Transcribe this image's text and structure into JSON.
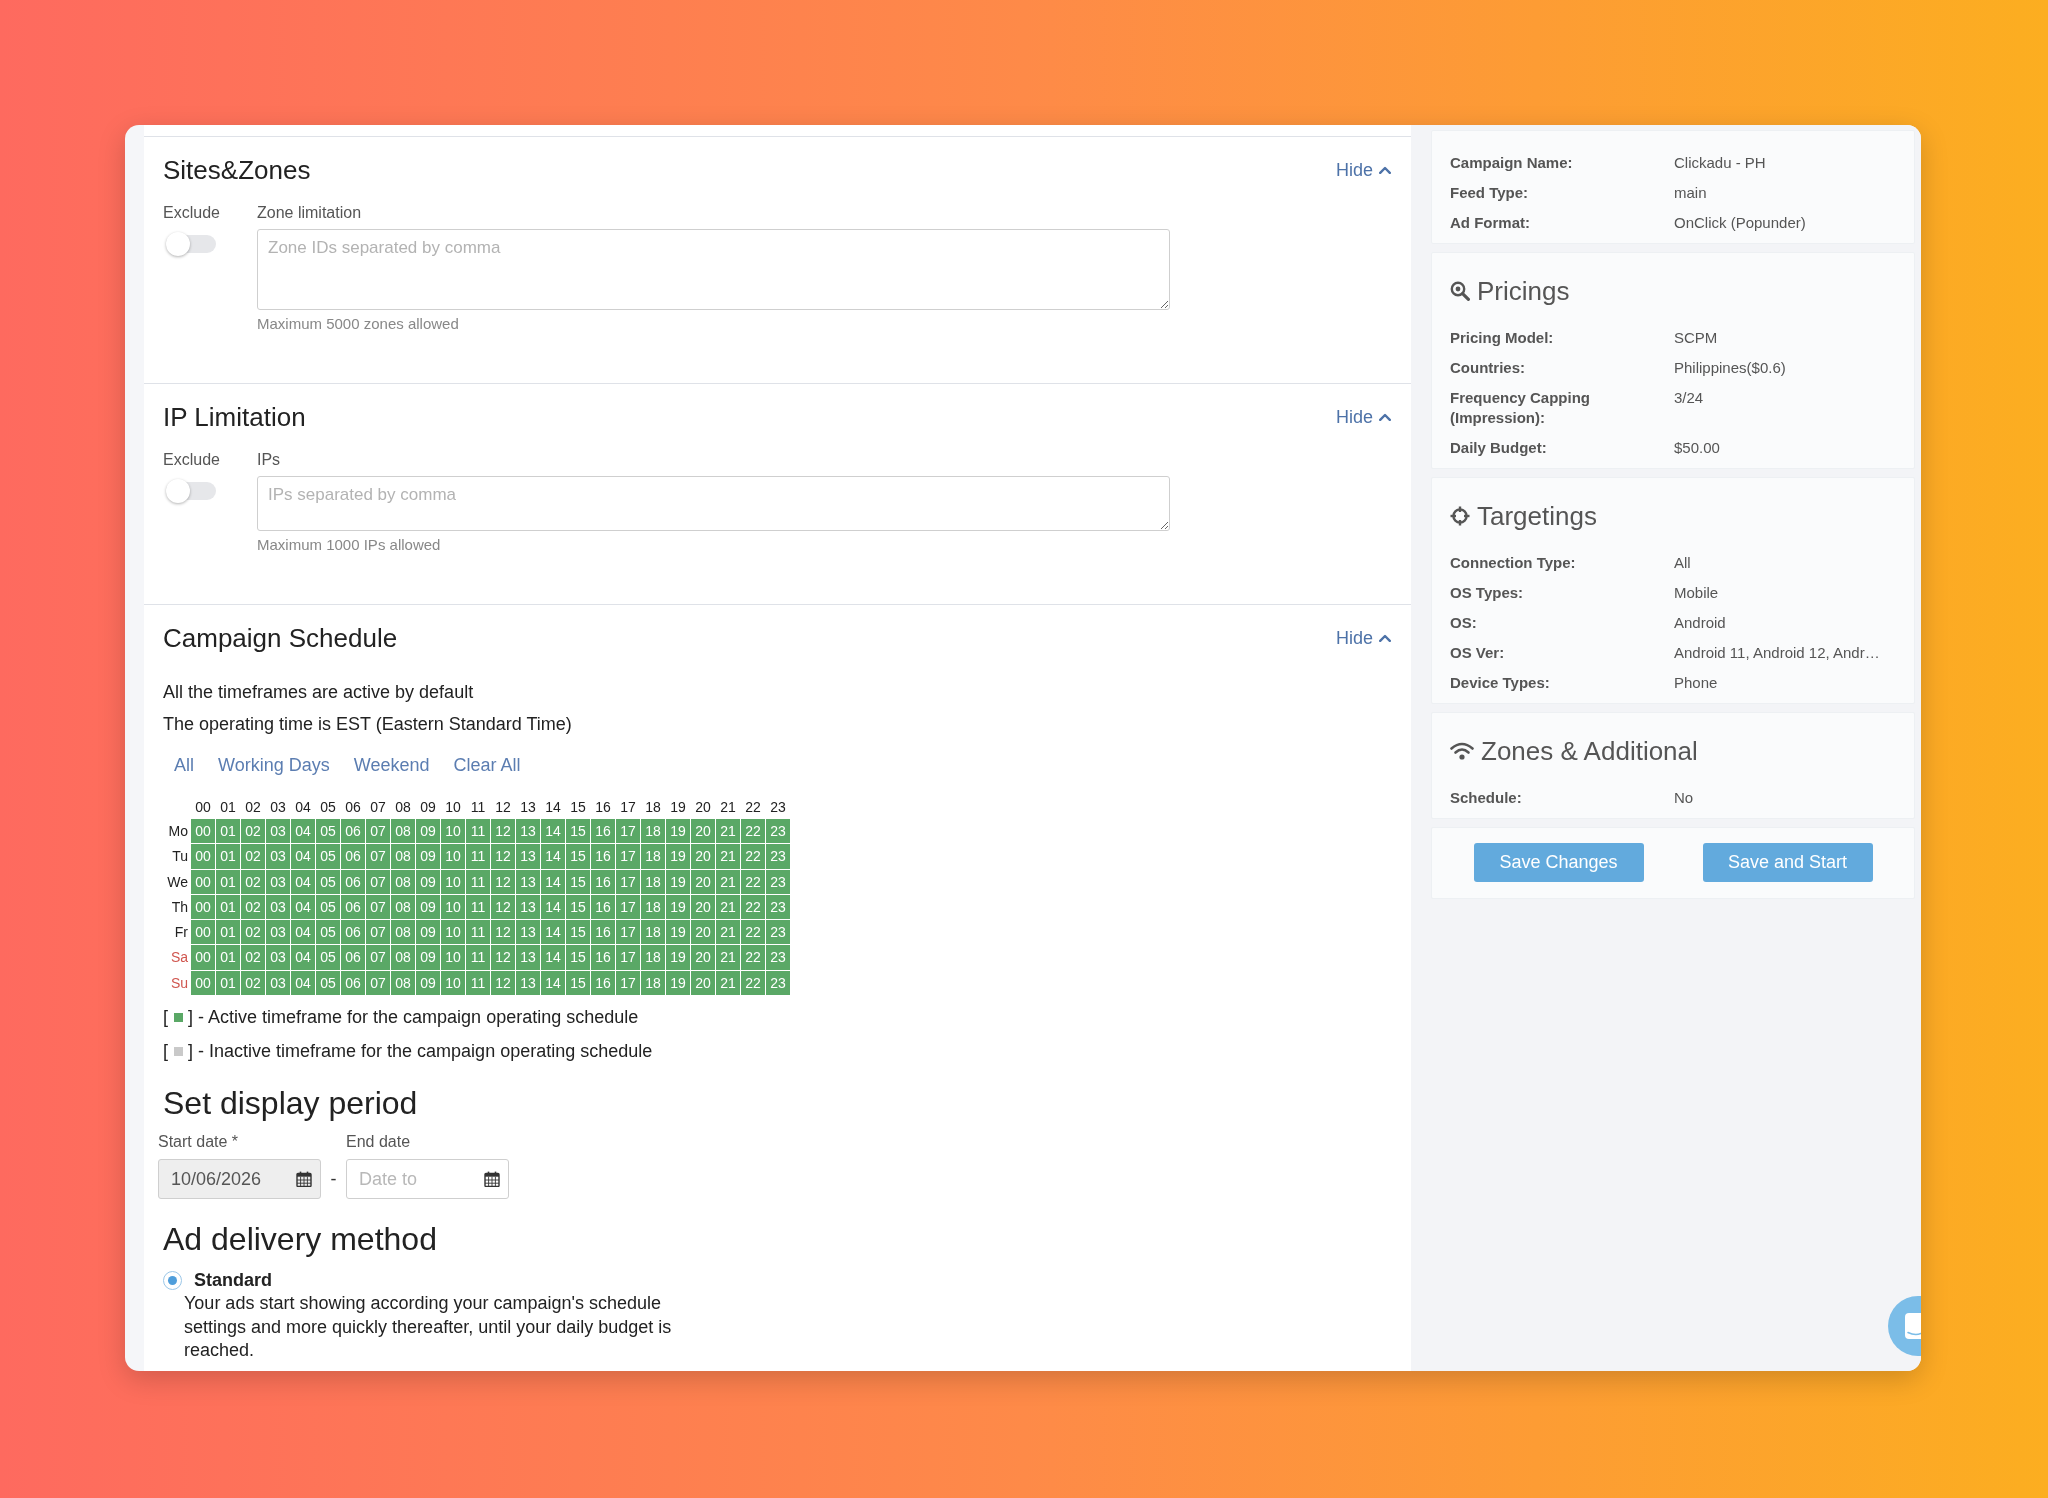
{
  "sites_zones": {
    "title": "Sites&Zones",
    "hide": "Hide",
    "exclude": {
      "label": "Exclude",
      "on": false
    },
    "field": {
      "label": "Zone limitation",
      "placeholder": "Zone IDs separated by comma",
      "help": "Maximum 5000 zones allowed"
    }
  },
  "ip_limitation": {
    "title": "IP Limitation",
    "hide": "Hide",
    "exclude": {
      "label": "Exclude",
      "on": false
    },
    "field": {
      "label": "IPs",
      "placeholder": "IPs separated by comma",
      "help": "Maximum 1000 IPs allowed"
    }
  },
  "schedule": {
    "title": "Campaign Schedule",
    "hide": "Hide",
    "notes": [
      "All the timeframes are active by default",
      "The operating time is EST (Eastern Standard Time)"
    ],
    "presets": [
      "All",
      "Working Days",
      "Weekend",
      "Clear All"
    ],
    "hours": [
      "00",
      "01",
      "02",
      "03",
      "04",
      "05",
      "06",
      "07",
      "08",
      "09",
      "10",
      "11",
      "12",
      "13",
      "14",
      "15",
      "16",
      "17",
      "18",
      "19",
      "20",
      "21",
      "22",
      "23"
    ],
    "days": [
      {
        "label": "Mo",
        "weekend": false,
        "slots": [
          {
            "hour": "00",
            "active": true
          },
          {
            "hour": "01",
            "active": true
          },
          {
            "hour": "02",
            "active": true
          },
          {
            "hour": "03",
            "active": true
          },
          {
            "hour": "04",
            "active": true
          },
          {
            "hour": "05",
            "active": true
          },
          {
            "hour": "06",
            "active": true
          },
          {
            "hour": "07",
            "active": true
          },
          {
            "hour": "08",
            "active": true
          },
          {
            "hour": "09",
            "active": true
          },
          {
            "hour": "10",
            "active": true
          },
          {
            "hour": "11",
            "active": true
          },
          {
            "hour": "12",
            "active": true
          },
          {
            "hour": "13",
            "active": true
          },
          {
            "hour": "14",
            "active": true
          },
          {
            "hour": "15",
            "active": true
          },
          {
            "hour": "16",
            "active": true
          },
          {
            "hour": "17",
            "active": true
          },
          {
            "hour": "18",
            "active": true
          },
          {
            "hour": "19",
            "active": true
          },
          {
            "hour": "20",
            "active": true
          },
          {
            "hour": "21",
            "active": true
          },
          {
            "hour": "22",
            "active": true
          },
          {
            "hour": "23",
            "active": true
          }
        ]
      },
      {
        "label": "Tu",
        "weekend": false,
        "slots": [
          {
            "hour": "00",
            "active": true
          },
          {
            "hour": "01",
            "active": true
          },
          {
            "hour": "02",
            "active": true
          },
          {
            "hour": "03",
            "active": true
          },
          {
            "hour": "04",
            "active": true
          },
          {
            "hour": "05",
            "active": true
          },
          {
            "hour": "06",
            "active": true
          },
          {
            "hour": "07",
            "active": true
          },
          {
            "hour": "08",
            "active": true
          },
          {
            "hour": "09",
            "active": true
          },
          {
            "hour": "10",
            "active": true
          },
          {
            "hour": "11",
            "active": true
          },
          {
            "hour": "12",
            "active": true
          },
          {
            "hour": "13",
            "active": true
          },
          {
            "hour": "14",
            "active": true
          },
          {
            "hour": "15",
            "active": true
          },
          {
            "hour": "16",
            "active": true
          },
          {
            "hour": "17",
            "active": true
          },
          {
            "hour": "18",
            "active": true
          },
          {
            "hour": "19",
            "active": true
          },
          {
            "hour": "20",
            "active": true
          },
          {
            "hour": "21",
            "active": true
          },
          {
            "hour": "22",
            "active": true
          },
          {
            "hour": "23",
            "active": true
          }
        ]
      },
      {
        "label": "We",
        "weekend": false,
        "slots": [
          {
            "hour": "00",
            "active": true
          },
          {
            "hour": "01",
            "active": true
          },
          {
            "hour": "02",
            "active": true
          },
          {
            "hour": "03",
            "active": true
          },
          {
            "hour": "04",
            "active": true
          },
          {
            "hour": "05",
            "active": true
          },
          {
            "hour": "06",
            "active": true
          },
          {
            "hour": "07",
            "active": true
          },
          {
            "hour": "08",
            "active": true
          },
          {
            "hour": "09",
            "active": true
          },
          {
            "hour": "10",
            "active": true
          },
          {
            "hour": "11",
            "active": true
          },
          {
            "hour": "12",
            "active": true
          },
          {
            "hour": "13",
            "active": true
          },
          {
            "hour": "14",
            "active": true
          },
          {
            "hour": "15",
            "active": true
          },
          {
            "hour": "16",
            "active": true
          },
          {
            "hour": "17",
            "active": true
          },
          {
            "hour": "18",
            "active": true
          },
          {
            "hour": "19",
            "active": true
          },
          {
            "hour": "20",
            "active": true
          },
          {
            "hour": "21",
            "active": true
          },
          {
            "hour": "22",
            "active": true
          },
          {
            "hour": "23",
            "active": true
          }
        ]
      },
      {
        "label": "Th",
        "weekend": false,
        "slots": [
          {
            "hour": "00",
            "active": true
          },
          {
            "hour": "01",
            "active": true
          },
          {
            "hour": "02",
            "active": true
          },
          {
            "hour": "03",
            "active": true
          },
          {
            "hour": "04",
            "active": true
          },
          {
            "hour": "05",
            "active": true
          },
          {
            "hour": "06",
            "active": true
          },
          {
            "hour": "07",
            "active": true
          },
          {
            "hour": "08",
            "active": true
          },
          {
            "hour": "09",
            "active": true
          },
          {
            "hour": "10",
            "active": true
          },
          {
            "hour": "11",
            "active": true
          },
          {
            "hour": "12",
            "active": true
          },
          {
            "hour": "13",
            "active": true
          },
          {
            "hour": "14",
            "active": true
          },
          {
            "hour": "15",
            "active": true
          },
          {
            "hour": "16",
            "active": true
          },
          {
            "hour": "17",
            "active": true
          },
          {
            "hour": "18",
            "active": true
          },
          {
            "hour": "19",
            "active": true
          },
          {
            "hour": "20",
            "active": true
          },
          {
            "hour": "21",
            "active": true
          },
          {
            "hour": "22",
            "active": true
          },
          {
            "hour": "23",
            "active": true
          }
        ]
      },
      {
        "label": "Fr",
        "weekend": false,
        "slots": [
          {
            "hour": "00",
            "active": true
          },
          {
            "hour": "01",
            "active": true
          },
          {
            "hour": "02",
            "active": true
          },
          {
            "hour": "03",
            "active": true
          },
          {
            "hour": "04",
            "active": true
          },
          {
            "hour": "05",
            "active": true
          },
          {
            "hour": "06",
            "active": true
          },
          {
            "hour": "07",
            "active": true
          },
          {
            "hour": "08",
            "active": true
          },
          {
            "hour": "09",
            "active": true
          },
          {
            "hour": "10",
            "active": true
          },
          {
            "hour": "11",
            "active": true
          },
          {
            "hour": "12",
            "active": true
          },
          {
            "hour": "13",
            "active": true
          },
          {
            "hour": "14",
            "active": true
          },
          {
            "hour": "15",
            "active": true
          },
          {
            "hour": "16",
            "active": true
          },
          {
            "hour": "17",
            "active": true
          },
          {
            "hour": "18",
            "active": true
          },
          {
            "hour": "19",
            "active": true
          },
          {
            "hour": "20",
            "active": true
          },
          {
            "hour": "21",
            "active": true
          },
          {
            "hour": "22",
            "active": true
          },
          {
            "hour": "23",
            "active": true
          }
        ]
      },
      {
        "label": "Sa",
        "weekend": true,
        "slots": [
          {
            "hour": "00",
            "active": true
          },
          {
            "hour": "01",
            "active": true
          },
          {
            "hour": "02",
            "active": true
          },
          {
            "hour": "03",
            "active": true
          },
          {
            "hour": "04",
            "active": true
          },
          {
            "hour": "05",
            "active": true
          },
          {
            "hour": "06",
            "active": true
          },
          {
            "hour": "07",
            "active": true
          },
          {
            "hour": "08",
            "active": true
          },
          {
            "hour": "09",
            "active": true
          },
          {
            "hour": "10",
            "active": true
          },
          {
            "hour": "11",
            "active": true
          },
          {
            "hour": "12",
            "active": true
          },
          {
            "hour": "13",
            "active": true
          },
          {
            "hour": "14",
            "active": true
          },
          {
            "hour": "15",
            "active": true
          },
          {
            "hour": "16",
            "active": true
          },
          {
            "hour": "17",
            "active": true
          },
          {
            "hour": "18",
            "active": true
          },
          {
            "hour": "19",
            "active": true
          },
          {
            "hour": "20",
            "active": true
          },
          {
            "hour": "21",
            "active": true
          },
          {
            "hour": "22",
            "active": true
          },
          {
            "hour": "23",
            "active": true
          }
        ]
      },
      {
        "label": "Su",
        "weekend": true,
        "slots": [
          {
            "hour": "00",
            "active": true
          },
          {
            "hour": "01",
            "active": true
          },
          {
            "hour": "02",
            "active": true
          },
          {
            "hour": "03",
            "active": true
          },
          {
            "hour": "04",
            "active": true
          },
          {
            "hour": "05",
            "active": true
          },
          {
            "hour": "06",
            "active": true
          },
          {
            "hour": "07",
            "active": true
          },
          {
            "hour": "08",
            "active": true
          },
          {
            "hour": "09",
            "active": true
          },
          {
            "hour": "10",
            "active": true
          },
          {
            "hour": "11",
            "active": true
          },
          {
            "hour": "12",
            "active": true
          },
          {
            "hour": "13",
            "active": true
          },
          {
            "hour": "14",
            "active": true
          },
          {
            "hour": "15",
            "active": true
          },
          {
            "hour": "16",
            "active": true
          },
          {
            "hour": "17",
            "active": true
          },
          {
            "hour": "18",
            "active": true
          },
          {
            "hour": "19",
            "active": true
          },
          {
            "hour": "20",
            "active": true
          },
          {
            "hour": "21",
            "active": true
          },
          {
            "hour": "22",
            "active": true
          },
          {
            "hour": "23",
            "active": true
          }
        ]
      }
    ],
    "legend": [
      {
        "open": "[",
        "text": "] - Active timeframe for the campaign operating schedule",
        "active": true
      },
      {
        "open": "[",
        "text": "] - Inactive timeframe for the campaign operating schedule",
        "active": false
      }
    ]
  },
  "display_period": {
    "title": "Set display period",
    "start": {
      "label": "Start date *",
      "value": "10/06/2026",
      "disabled": true
    },
    "separator": "-",
    "end": {
      "label": "End date",
      "placeholder": "Date to",
      "disabled": false
    }
  },
  "ad_delivery": {
    "title": "Ad delivery method",
    "options": [
      {
        "label": "Standard",
        "description": "Your ads start showing according your campaign's schedule settings and more quickly thereafter, until your daily budget is reached.",
        "selected": true
      }
    ]
  },
  "summary": {
    "cards": [
      {
        "kind": "general",
        "rows": [
          {
            "label": "Campaign Name:",
            "value": "Clickadu - PH"
          },
          {
            "label": "Feed Type:",
            "value": "main"
          },
          {
            "label": "Ad Format:",
            "value": "OnClick (Popunder)"
          }
        ]
      },
      {
        "kind": "pricing",
        "title": "Pricings",
        "rows": [
          {
            "label": "Pricing Model:",
            "value": "SCPM"
          },
          {
            "label": "Countries:",
            "value": "Philippines($0.6)"
          },
          {
            "label": "Frequency Capping (Impression):",
            "value": "3/24"
          },
          {
            "label": "Daily Budget:",
            "value": "$50.00"
          }
        ]
      },
      {
        "kind": "targeting",
        "title": "Targetings",
        "rows": [
          {
            "label": "Connection Type:",
            "value": "All"
          },
          {
            "label": "OS Types:",
            "value": "Mobile"
          },
          {
            "label": "OS:",
            "value": "Android"
          },
          {
            "label": "OS Ver:",
            "value": "Android 11, Android 12, Andr…"
          },
          {
            "label": "Device Types:",
            "value": "Phone"
          }
        ]
      },
      {
        "kind": "zones",
        "title": "Zones & Additional",
        "rows": [
          {
            "label": "Schedule:",
            "value": "No"
          }
        ]
      }
    ],
    "buttons": [
      "Save Changes",
      "Save and Start"
    ]
  }
}
